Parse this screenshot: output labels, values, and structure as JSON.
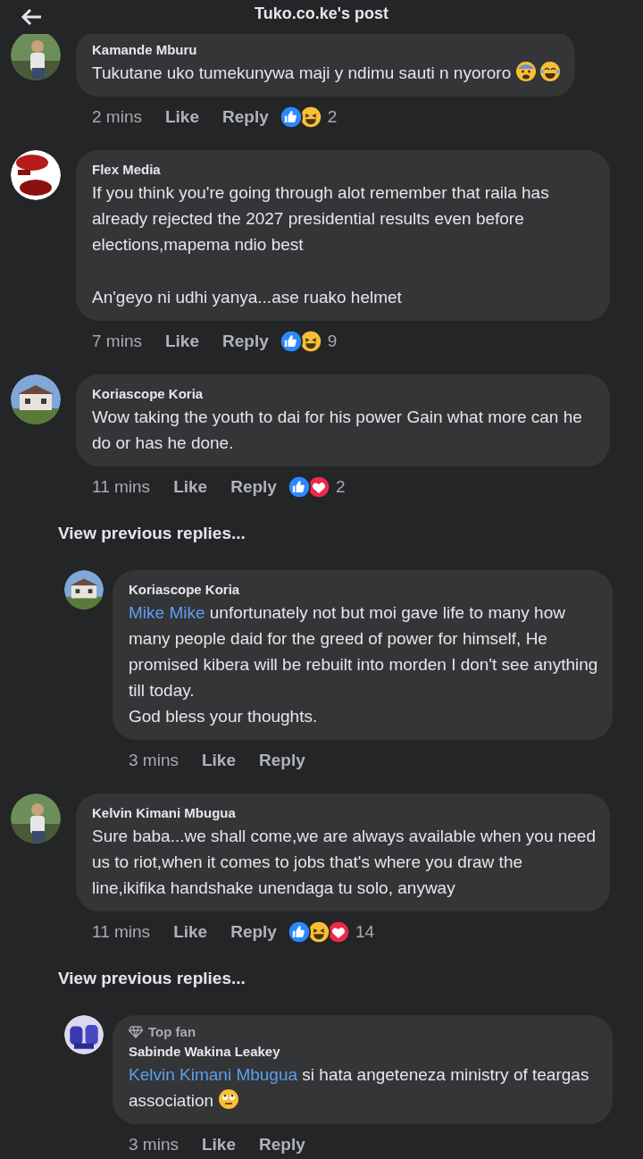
{
  "header": {
    "title": "Tuko.co.ke's post"
  },
  "comments": [
    {
      "author": "Kamande Mburu",
      "paragraphs": [
        "Tukutane uko tumekunywa maji y ndimu sauti n nyororo"
      ],
      "emojis": [
        {
          "kind": "anxious"
        },
        {
          "kind": "joy"
        }
      ],
      "time": "2 mins",
      "like": "Like",
      "reply": "Reply",
      "reactions": [
        {
          "kind": "like"
        },
        {
          "kind": "haha"
        }
      ],
      "count": "2"
    },
    {
      "author": "Flex Media",
      "paragraphs": [
        "If you think you're going through alot remember that raila has already rejected the 2027 presidential results even before elections,mapema ndio best",
        "An'geyo ni udhi yanya...ase ruako helmet"
      ],
      "time": "7 mins",
      "like": "Like",
      "reply": "Reply",
      "reactions": [
        {
          "kind": "like"
        },
        {
          "kind": "haha"
        }
      ],
      "count": "9"
    },
    {
      "author": "Koriascope Koria",
      "paragraphs": [
        "Wow taking the youth to dai for his power Gain what more can he do or has he done."
      ],
      "time": "11 mins",
      "like": "Like",
      "reply": "Reply",
      "reactions": [
        {
          "kind": "like"
        },
        {
          "kind": "love"
        }
      ],
      "count": "2",
      "view_previous": "View previous replies...",
      "replies": [
        {
          "author": "Koriascope Koria",
          "mention": "Mike Mike",
          "paragraphs": [
            "unfortunately not but moi gave life to many how many people daid for the greed of power for himself, He promised kibera will be rebuilt into morden I don't see anything till today.\nGod bless your thoughts."
          ],
          "time": "3 mins",
          "like": "Like",
          "reply": "Reply"
        }
      ]
    },
    {
      "author": "Kelvin Kimani Mbugua",
      "paragraphs": [
        "Sure baba...we shall come,we are always available when you need us to riot,when it comes to jobs that's where you draw the line,ikifika handshake unendaga tu solo, anyway"
      ],
      "time": "11 mins",
      "like": "Like",
      "reply": "Reply",
      "reactions": [
        {
          "kind": "like"
        },
        {
          "kind": "haha"
        },
        {
          "kind": "love"
        }
      ],
      "count": "14",
      "view_previous": "View previous replies...",
      "replies": [
        {
          "badge": "Top fan",
          "author": "Sabinde Wakina Leakey",
          "mention": "Kelvin Kimani Mbugua",
          "paragraphs": [
            "si hata angeteneza ministry of teargas association"
          ],
          "emojis": [
            {
              "kind": "eyeroll"
            }
          ],
          "time": "3 mins",
          "like": "Like",
          "reply": "Reply"
        }
      ]
    }
  ]
}
